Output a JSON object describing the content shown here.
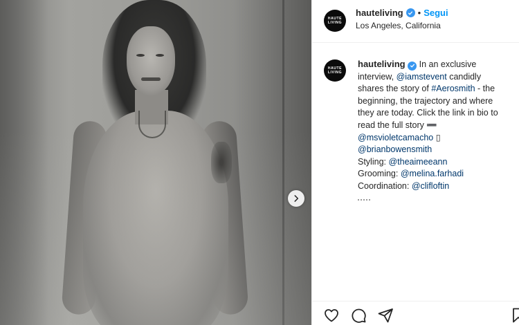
{
  "post": {
    "photo_alt": "Black-and-white photo of a long-haired man behind a steamy shower glass",
    "next_icon": "chevron-right-icon"
  },
  "header": {
    "avatar_text_top": "HAUTE",
    "avatar_text_bottom": "LIVING",
    "username": "hauteliving",
    "separator": "•",
    "follow_label": "Segui",
    "location": "Los Angeles, California"
  },
  "caption": {
    "username": "hauteliving",
    "lines": [
      "In an exclusive",
      "interview,",
      "@iamstevent",
      "candidly",
      "shares the story of",
      "#Aerosmith",
      "- the",
      "beginning, the trajectory and where",
      "they are today. Click the link in bio to",
      "read the full story",
      "➖",
      "@msvioletcamacho",
      "▯",
      "@brianbowensmith",
      "Styling:",
      "@theaimeeann",
      "Grooming:",
      "@melina.farhadi",
      "Coordination:",
      "@clifloftin"
    ]
  },
  "actions": {
    "like_icon": "heart-icon",
    "comment_icon": "comment-icon",
    "share_icon": "send-icon",
    "save_icon": "bookmark-icon"
  },
  "colors": {
    "link": "#00376b",
    "follow": "#0095f6",
    "verified": "#3897f0",
    "text": "#262626"
  }
}
